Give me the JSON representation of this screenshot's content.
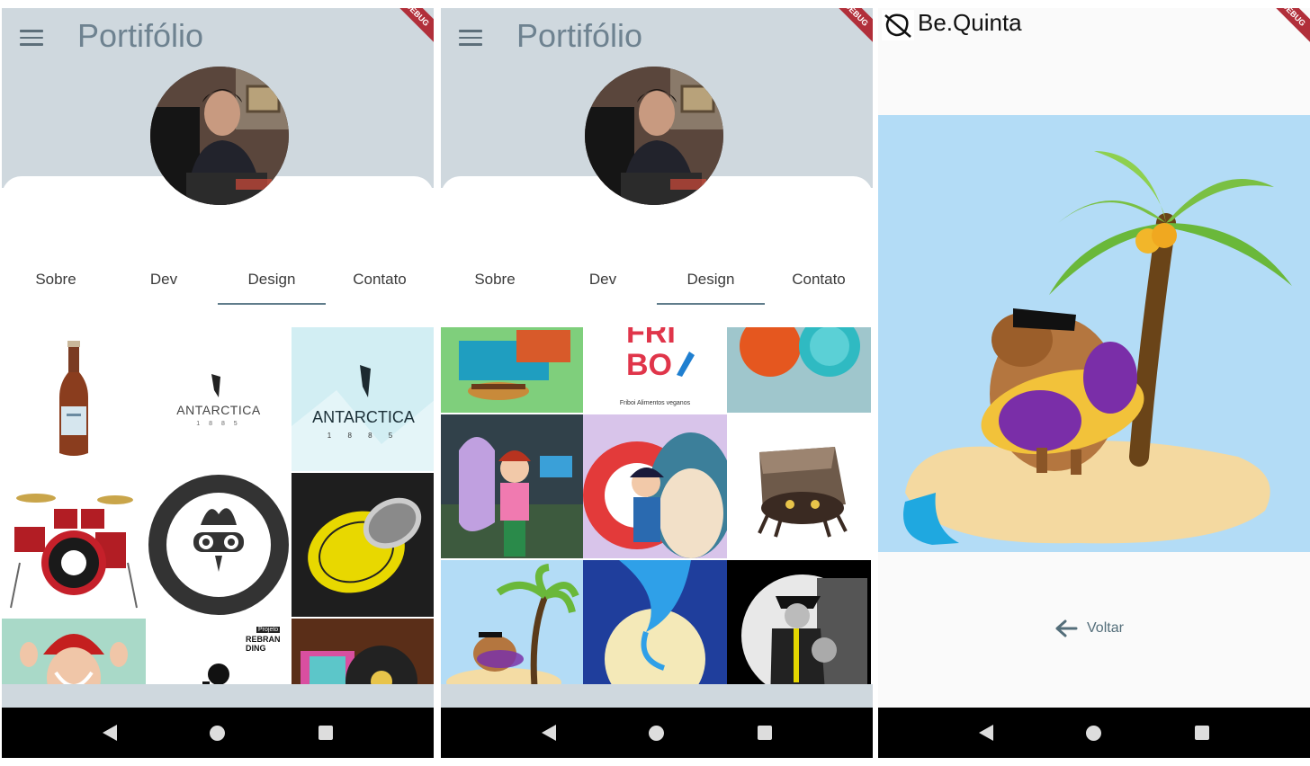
{
  "screen1": {
    "title": "Portifólio",
    "tabs": [
      "Sobre",
      "Dev",
      "Design",
      "Contato"
    ],
    "active_tab": "Design",
    "tiles": [
      {
        "name": "beer-bottle-tile"
      },
      {
        "name": "antarctica-logo-white-tile",
        "text": "ANTARCTICA",
        "sub": "1 8 8 5"
      },
      {
        "name": "antarctica-logo-blue-tile",
        "text": "ANTARCTICA",
        "sub": "1 8 8 5"
      },
      {
        "name": "drum-kit-tile"
      },
      {
        "name": "sadia-badge-tile",
        "text_top": "1944 ★ SADIA",
        "text_bottom": "SADIA ★ 1944"
      },
      {
        "name": "sadia-button-yellow-tile"
      },
      {
        "name": "red-hat-girl-tile"
      },
      {
        "name": "rebranding-tile",
        "text": "REBRAN DING",
        "label": "Projeto"
      },
      {
        "name": "vinyl-record-tile"
      }
    ]
  },
  "screen2": {
    "title": "Portifólio",
    "tabs": [
      "Sobre",
      "Dev",
      "Design",
      "Contato"
    ],
    "active_tab": "Design",
    "tiles": [
      {
        "name": "burger-box-tile"
      },
      {
        "name": "friboi-logo-tile",
        "text": "FRI BO",
        "caption": "Friboi  Alimentos veganos"
      },
      {
        "name": "plates-tile"
      },
      {
        "name": "anime-trainer-tile"
      },
      {
        "name": "pokemon-snorlax-tile"
      },
      {
        "name": "rock-crab-tile"
      },
      {
        "name": "capybara-island-tile"
      },
      {
        "name": "moon-dragon-tile"
      },
      {
        "name": "noir-detective-tile"
      }
    ]
  },
  "screen3": {
    "app_title": "Be.Quinta",
    "back_label": "Voltar"
  },
  "debug_label": "DEBUG",
  "colors": {
    "header": "#cfd8de",
    "title": "#6e8290",
    "tab_indicator": "#607d8b",
    "sky": "#b3dcf6",
    "navbar": "#000000"
  }
}
